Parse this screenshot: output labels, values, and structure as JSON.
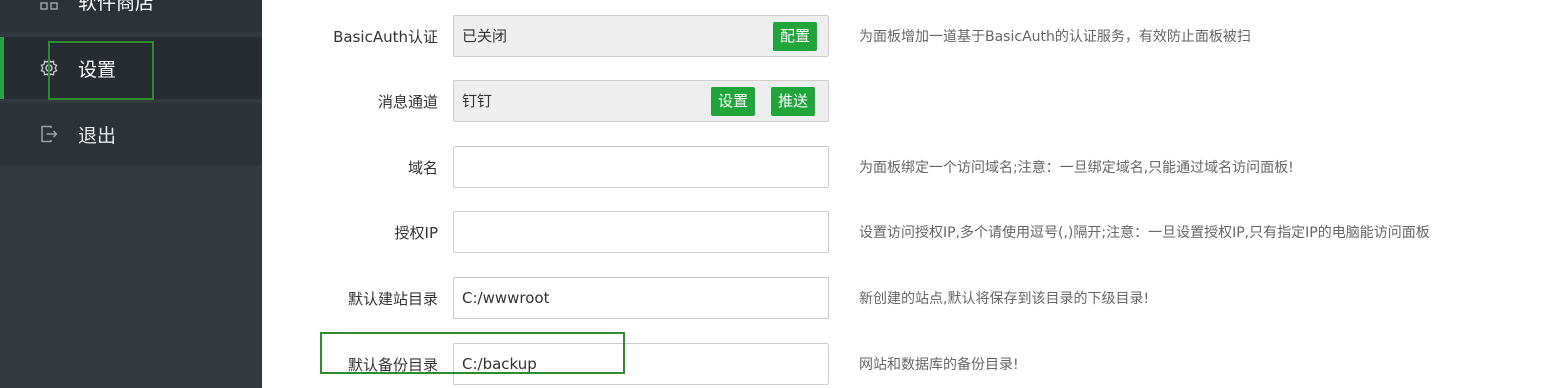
{
  "sidebar": {
    "items": [
      {
        "label": "软件商店",
        "icon": "grid-icon"
      },
      {
        "label": "设置",
        "icon": "gear-icon"
      },
      {
        "label": "退出",
        "icon": "logout-icon"
      }
    ]
  },
  "settings": {
    "basic_auth": {
      "label": "BasicAuth认证",
      "value": "已关闭",
      "button": "配置",
      "hint": "为面板增加一道基于BasicAuth的认证服务，有效防止面板被扫"
    },
    "message_channel": {
      "label": "消息通道",
      "value": "钉钉",
      "button_set": "设置",
      "button_push": "推送"
    },
    "domain": {
      "label": "域名",
      "value": "",
      "hint": "为面板绑定一个访问域名;注意：一旦绑定域名,只能通过域名访问面板!"
    },
    "auth_ip": {
      "label": "授权IP",
      "value": "",
      "hint": "设置访问授权IP,多个请使用逗号(,)隔开;注意：一旦设置授权IP,只有指定IP的电脑能访问面板"
    },
    "site_dir": {
      "label": "默认建站目录",
      "value": "C:/wwwroot",
      "hint": "新创建的站点,默认将保存到该目录的下级目录!"
    },
    "backup_dir": {
      "label": "默认备份目录",
      "value": "C:/backup",
      "hint": "网站和数据库的备份目录!"
    }
  },
  "colors": {
    "sidebar_bg": "#323a40",
    "accent_green": "#20a53a",
    "highlight_box": "#2e8b2e"
  }
}
